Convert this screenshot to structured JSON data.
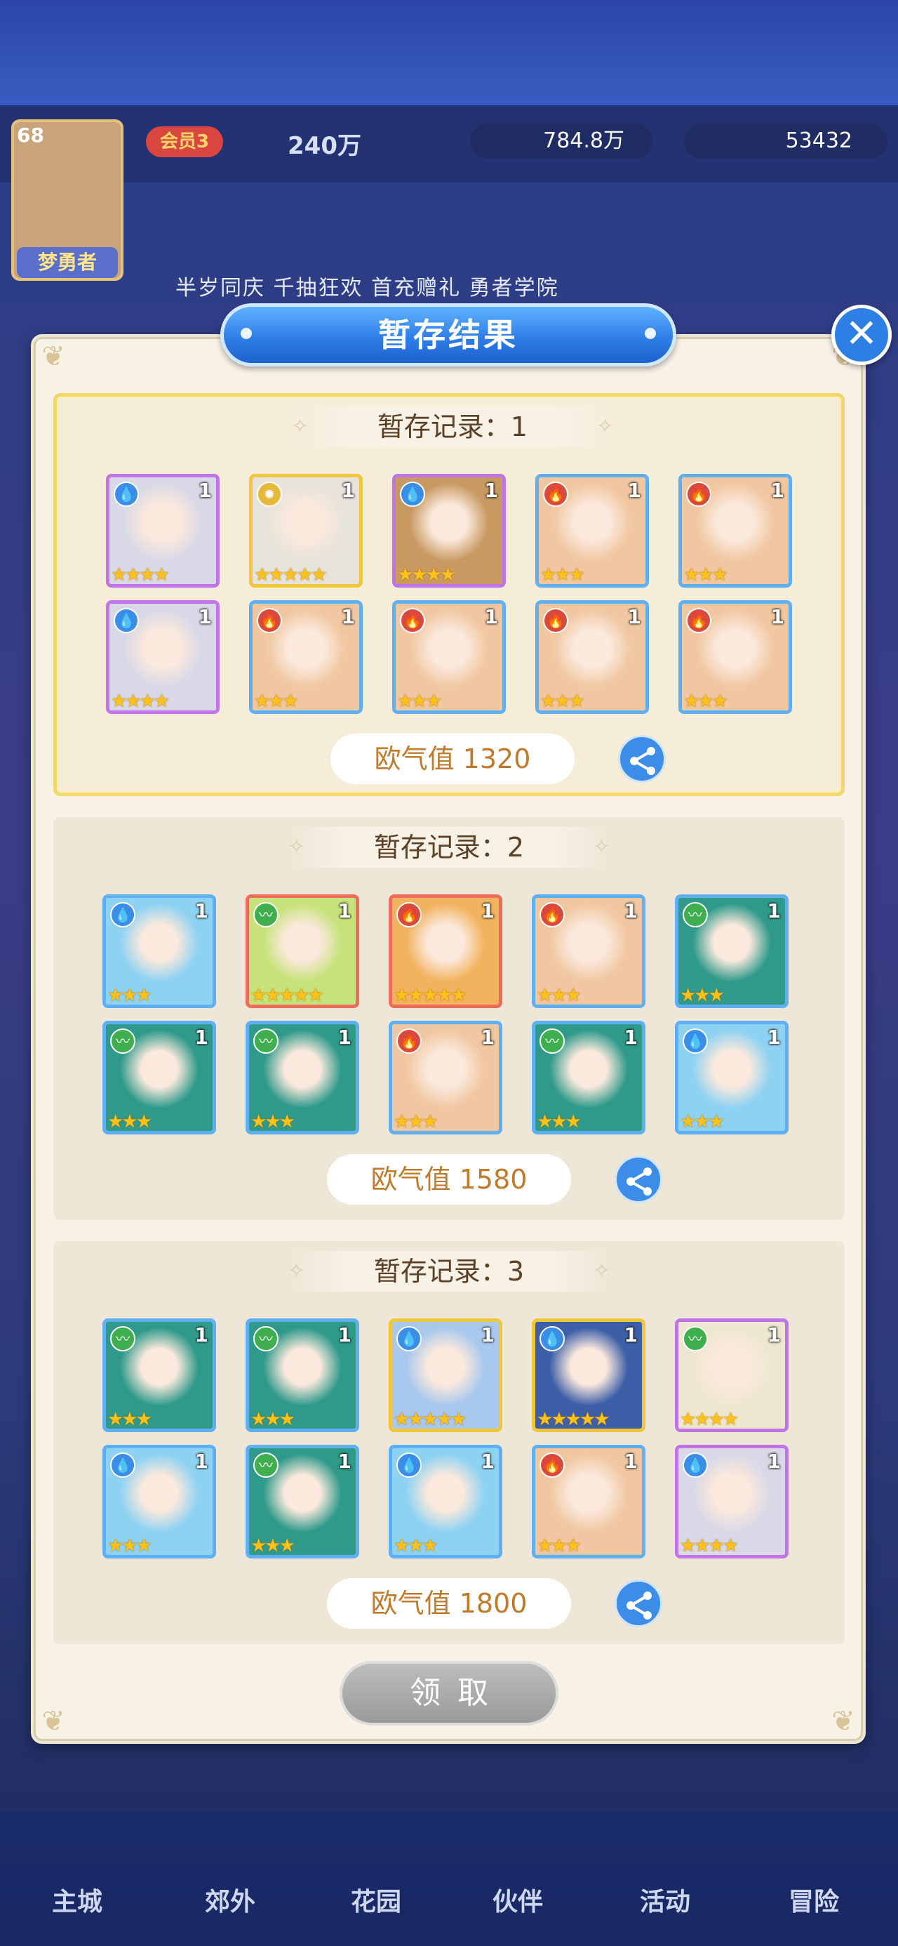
{
  "background": {
    "hud": {
      "level": "68",
      "player_name": "梦勇者",
      "vip": "会员3",
      "power": "240万",
      "coins": "784.8万",
      "gems": "53432",
      "events_text": "半岁同庆  千抽狂欢  首充赠礼  勇者学院"
    },
    "nav": [
      "主城",
      "郊外",
      "花园",
      "伙伴",
      "活动",
      "冒险"
    ]
  },
  "modal": {
    "title": "暂存结果",
    "close_icon": "close-icon",
    "records": [
      {
        "label": "暂存记录：1",
        "selected": true,
        "luck_text": "欧气值 1320",
        "cards": [
          {
            "element": "water",
            "rarity": "purple",
            "stars": 4,
            "count": "1",
            "color": "#d8d8e6"
          },
          {
            "element": "light",
            "rarity": "gold",
            "stars": 5,
            "count": "1",
            "color": "#e6e3da"
          },
          {
            "element": "water",
            "rarity": "purple",
            "stars": 4,
            "count": "1",
            "color": "#c89a62"
          },
          {
            "element": "fire",
            "rarity": "blue",
            "stars": 3,
            "count": "1",
            "color": "#f0c7a0"
          },
          {
            "element": "fire",
            "rarity": "blue",
            "stars": 3,
            "count": "1",
            "color": "#f0c7a0"
          },
          {
            "element": "water",
            "rarity": "purple",
            "stars": 4,
            "count": "1",
            "color": "#d8d8e6"
          },
          {
            "element": "fire",
            "rarity": "blue",
            "stars": 3,
            "count": "1",
            "color": "#f0c7a0"
          },
          {
            "element": "fire",
            "rarity": "blue",
            "stars": 3,
            "count": "1",
            "color": "#f0c7a0"
          },
          {
            "element": "fire",
            "rarity": "blue",
            "stars": 3,
            "count": "1",
            "color": "#f0c7a0"
          },
          {
            "element": "fire",
            "rarity": "blue",
            "stars": 3,
            "count": "1",
            "color": "#f0c7a0"
          }
        ]
      },
      {
        "label": "暂存记录：2",
        "selected": false,
        "luck_text": "欧气值 1580",
        "cards": [
          {
            "element": "water",
            "rarity": "blue",
            "stars": 3,
            "count": "1",
            "color": "#8ed2f2"
          },
          {
            "element": "wind",
            "rarity": "red",
            "stars": 5,
            "count": "1",
            "color": "#c7e27a"
          },
          {
            "element": "fire",
            "rarity": "red",
            "stars": 5,
            "count": "1",
            "color": "#f2b35f"
          },
          {
            "element": "fire",
            "rarity": "blue",
            "stars": 3,
            "count": "1",
            "color": "#f0c7a0"
          },
          {
            "element": "wind",
            "rarity": "blue",
            "stars": 3,
            "count": "1",
            "color": "#2f9a8a"
          },
          {
            "element": "wind",
            "rarity": "blue",
            "stars": 3,
            "count": "1",
            "color": "#2f9a8a"
          },
          {
            "element": "wind",
            "rarity": "blue",
            "stars": 3,
            "count": "1",
            "color": "#2f9a8a"
          },
          {
            "element": "fire",
            "rarity": "blue",
            "stars": 3,
            "count": "1",
            "color": "#f0c7a0"
          },
          {
            "element": "wind",
            "rarity": "blue",
            "stars": 3,
            "count": "1",
            "color": "#2f9a8a"
          },
          {
            "element": "water",
            "rarity": "blue",
            "stars": 3,
            "count": "1",
            "color": "#8ed2f2"
          }
        ]
      },
      {
        "label": "暂存记录：3",
        "selected": false,
        "luck_text": "欧气值 1800",
        "cards": [
          {
            "element": "wind",
            "rarity": "blue",
            "stars": 3,
            "count": "1",
            "color": "#2f9a8a"
          },
          {
            "element": "wind",
            "rarity": "blue",
            "stars": 3,
            "count": "1",
            "color": "#2f9a8a"
          },
          {
            "element": "water",
            "rarity": "gold",
            "stars": 5,
            "count": "1",
            "color": "#a9c8ee"
          },
          {
            "element": "water",
            "rarity": "gold",
            "stars": 5,
            "count": "1",
            "color": "#3d5fa8"
          },
          {
            "element": "wind",
            "rarity": "purple",
            "stars": 4,
            "count": "1",
            "color": "#eee7cf"
          },
          {
            "element": "water",
            "rarity": "blue",
            "stars": 3,
            "count": "1",
            "color": "#8ed2f2"
          },
          {
            "element": "wind",
            "rarity": "blue",
            "stars": 3,
            "count": "1",
            "color": "#2f9a8a"
          },
          {
            "element": "water",
            "rarity": "blue",
            "stars": 3,
            "count": "1",
            "color": "#8ed2f2"
          },
          {
            "element": "fire",
            "rarity": "blue",
            "stars": 3,
            "count": "1",
            "color": "#f0c7a0"
          },
          {
            "element": "water",
            "rarity": "purple",
            "stars": 4,
            "count": "1",
            "color": "#d8d8e6"
          }
        ]
      }
    ],
    "claim_label": "领取"
  },
  "icons": {
    "water": "water-drop-icon",
    "fire": "flame-icon",
    "wind": "wind-icon",
    "light": "sun-icon",
    "share": "share-icon"
  }
}
